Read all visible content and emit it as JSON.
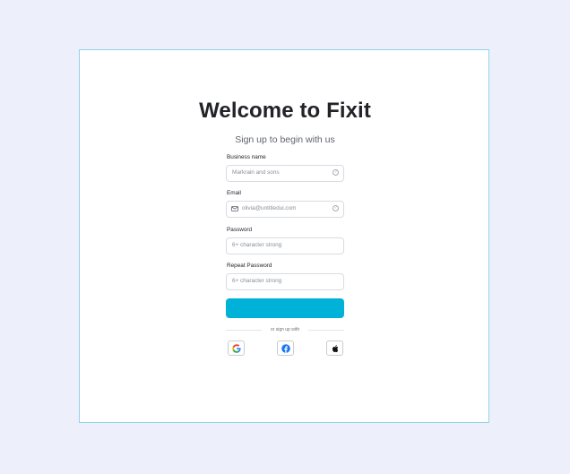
{
  "header": {
    "title": "Welcome to Fixit",
    "subtitle": "Sign up to begin with us"
  },
  "form": {
    "business": {
      "label": "Business name",
      "placeholder": "Markrain and sons",
      "help": "?"
    },
    "email": {
      "label": "Email",
      "placeholder": "olivia@untitledui.com",
      "help": "?"
    },
    "password": {
      "label": "Password",
      "placeholder": "6+ character strong"
    },
    "repeat_password": {
      "label": "Repeat Password",
      "placeholder": "6+ character strong"
    },
    "submit_label": ""
  },
  "divider_text": "or sign up with",
  "social": {
    "google_icon": "google-icon",
    "facebook_icon": "facebook-icon",
    "apple_icon": "apple-icon"
  },
  "colors": {
    "background": "#edf0fb",
    "card_border": "#8fd3ea",
    "accent": "#00b2d8",
    "title": "#222327"
  }
}
